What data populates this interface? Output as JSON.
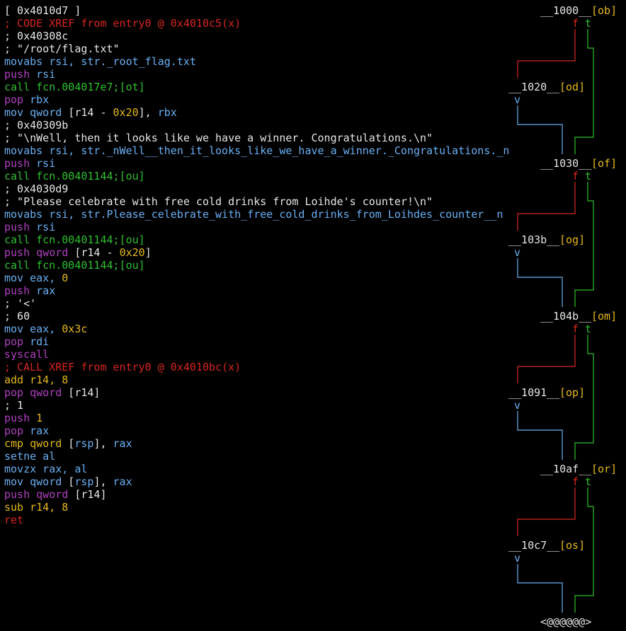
{
  "colors": {
    "background": "#000000",
    "text": "#e6e6e6",
    "red": "#d7261e",
    "blue": "#6ab0f3",
    "purple": "#b040c0",
    "green": "#2fc02f",
    "yellow": "#e5b91c"
  },
  "lines": [
    [
      {
        "t": "[ 0x4010d7 ]",
        "c": "white"
      }
    ],
    [
      {
        "t": "; CODE XREF from entry0 @ 0x4010c5(x)",
        "c": "red"
      }
    ],
    [
      {
        "t": "; 0x40308c",
        "c": "white"
      }
    ],
    [
      {
        "t": "; \"/root/flag.txt\"",
        "c": "white"
      }
    ],
    [
      {
        "t": "movabs rsi, str._root_flag.txt",
        "c": "blue"
      }
    ],
    [
      {
        "t": "push",
        "c": "purple"
      },
      {
        "t": " rsi",
        "c": "blue"
      }
    ],
    [
      {
        "t": "call fcn.004017e7",
        "c": "green"
      },
      {
        "t": ";[ot]",
        "c": "green"
      }
    ],
    [
      {
        "t": "pop",
        "c": "purple"
      },
      {
        "t": " rbx",
        "c": "blue"
      }
    ],
    [
      {
        "t": "mov qword ",
        "c": "blue"
      },
      {
        "t": "[r14 - ",
        "c": "white"
      },
      {
        "t": "0x20",
        "c": "yellow"
      },
      {
        "t": "], ",
        "c": "white"
      },
      {
        "t": "rbx",
        "c": "blue"
      }
    ],
    [
      {
        "t": "; 0x40309b",
        "c": "white"
      }
    ],
    [
      {
        "t": "; \"\\nWell, then it looks like we have a winner. Congratulations.\\n\"",
        "c": "white"
      }
    ],
    [
      {
        "t": "movabs rsi, str._nWell__then_it_looks_like_we_have_a_winner._Congratulations._n",
        "c": "blue"
      }
    ],
    [
      {
        "t": "push",
        "c": "purple"
      },
      {
        "t": " rsi",
        "c": "blue"
      }
    ],
    [
      {
        "t": "call fcn.00401144",
        "c": "green"
      },
      {
        "t": ";[ou]",
        "c": "green"
      }
    ],
    [
      {
        "t": "; 0x4030d9",
        "c": "white"
      }
    ],
    [
      {
        "t": "; \"Please celebrate with free cold drinks from Loihde's counter!\\n\"",
        "c": "white"
      }
    ],
    [
      {
        "t": "movabs rsi, str.Please_celebrate_with_free_cold_drinks_from_Loihdes_counter__n",
        "c": "blue"
      }
    ],
    [
      {
        "t": "push",
        "c": "purple"
      },
      {
        "t": " rsi",
        "c": "blue"
      }
    ],
    [
      {
        "t": "call fcn.00401144",
        "c": "green"
      },
      {
        "t": ";[ou]",
        "c": "green"
      }
    ],
    [
      {
        "t": "push qword",
        "c": "purple"
      },
      {
        "t": " [r14 - ",
        "c": "white"
      },
      {
        "t": "0x20",
        "c": "yellow"
      },
      {
        "t": "]",
        "c": "white"
      }
    ],
    [
      {
        "t": "call fcn.00401144",
        "c": "green"
      },
      {
        "t": ";[ou]",
        "c": "green"
      }
    ],
    [
      {
        "t": "mov eax, ",
        "c": "blue"
      },
      {
        "t": "0",
        "c": "yellow"
      }
    ],
    [
      {
        "t": "push",
        "c": "purple"
      },
      {
        "t": " rax",
        "c": "blue"
      }
    ],
    [
      {
        "t": "; '<'",
        "c": "white"
      }
    ],
    [
      {
        "t": "; 60",
        "c": "white"
      }
    ],
    [
      {
        "t": "mov eax, ",
        "c": "blue"
      },
      {
        "t": "0x3c",
        "c": "yellow"
      }
    ],
    [
      {
        "t": "pop",
        "c": "purple"
      },
      {
        "t": " rdi",
        "c": "blue"
      }
    ],
    [
      {
        "t": "syscall",
        "c": "purple"
      }
    ],
    [
      {
        "t": "; CALL XREF from entry0 @ 0x4010bc(x)",
        "c": "red"
      }
    ],
    [
      {
        "t": "add r14, ",
        "c": "yellow"
      },
      {
        "t": "8",
        "c": "yellow"
      }
    ],
    [
      {
        "t": "pop qword",
        "c": "purple"
      },
      {
        "t": " [r14]",
        "c": "white"
      }
    ],
    [
      {
        "t": "; 1",
        "c": "white"
      }
    ],
    [
      {
        "t": "push",
        "c": "purple"
      },
      {
        "t": " 1",
        "c": "yellow"
      }
    ],
    [
      {
        "t": "pop",
        "c": "purple"
      },
      {
        "t": " rax",
        "c": "blue"
      }
    ],
    [
      {
        "t": "cmp qword",
        "c": "yellow"
      },
      {
        "t": " [",
        "c": "white"
      },
      {
        "t": "rsp",
        "c": "blue"
      },
      {
        "t": "], ",
        "c": "white"
      },
      {
        "t": "rax",
        "c": "blue"
      }
    ],
    [
      {
        "t": "setne al",
        "c": "blue"
      }
    ],
    [
      {
        "t": "movzx rax, al",
        "c": "blue"
      }
    ],
    [
      {
        "t": "mov qword",
        "c": "blue"
      },
      {
        "t": " [",
        "c": "white"
      },
      {
        "t": "rsp",
        "c": "blue"
      },
      {
        "t": "], ",
        "c": "white"
      },
      {
        "t": "rax",
        "c": "blue"
      }
    ],
    [
      {
        "t": "push qword",
        "c": "purple"
      },
      {
        "t": " [r14]",
        "c": "white"
      }
    ],
    [
      {
        "t": "sub r14, ",
        "c": "yellow"
      },
      {
        "t": "8",
        "c": "yellow"
      }
    ],
    [
      {
        "t": "ret",
        "c": "red"
      }
    ]
  ],
  "graph": {
    "nodes": [
      {
        "addr": "__1000__",
        "tag": "[ob]"
      },
      {
        "addr": "__1020__",
        "tag": "[od]"
      },
      {
        "addr": "__1030__",
        "tag": "[of]"
      },
      {
        "addr": "__103b__",
        "tag": "[og]"
      },
      {
        "addr": "__104b__",
        "tag": "[om]"
      },
      {
        "addr": "__1091__",
        "tag": "[op]"
      },
      {
        "addr": "__10af__",
        "tag": "[or]"
      },
      {
        "addr": "__10c7__",
        "tag": "[os]"
      }
    ],
    "branch_false": "f",
    "branch_true": "t",
    "fallthrough": "v",
    "end_label": "<@@@@@@>"
  }
}
